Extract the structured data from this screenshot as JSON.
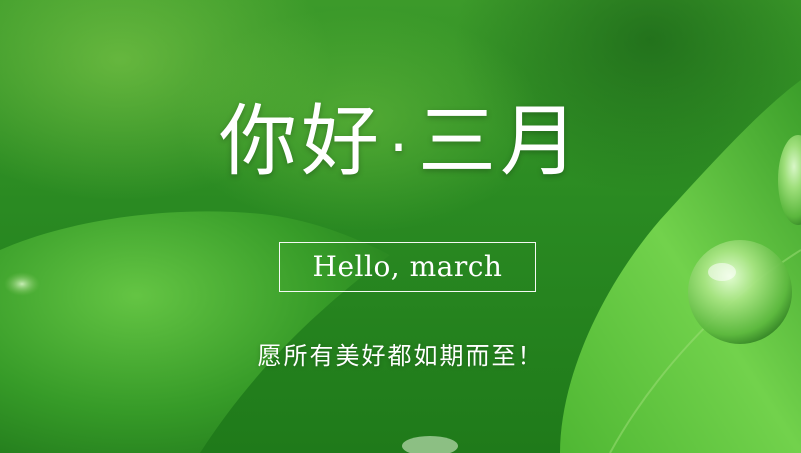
{
  "banner": {
    "title_part1": "你好",
    "title_separator": "·",
    "title_part2": "三月",
    "english_line": "Hello, march",
    "subtitle": "愿所有美好都如期而至！"
  },
  "colors": {
    "background_green": "#2a8a22",
    "leaf_green": "#5cc03a",
    "text": "#ffffff"
  }
}
